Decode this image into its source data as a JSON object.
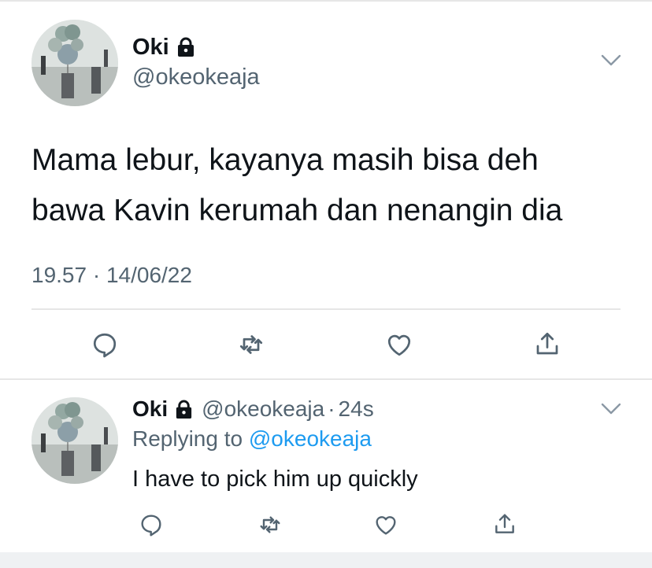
{
  "main_tweet": {
    "display_name": "Oki",
    "handle": "@okeokeaja",
    "text_line1": "Mama lebur, kayanya masih bisa deh",
    "text_line2": "bawa Kavin kerumah dan nenangin dia",
    "timestamp": "19.57 · 14/06/22"
  },
  "reply": {
    "display_name": "Oki",
    "handle": "@okeokeaja",
    "separator": "·",
    "time": "24s",
    "replying_prefix": "Replying to",
    "replying_mention": "@okeokeaja",
    "text": "I have to pick him up quickly"
  },
  "icons": {
    "lock": "lock-icon",
    "chevron": "chevron-down-icon",
    "reply": "reply-icon",
    "retweet": "retweet-icon",
    "like": "like-icon",
    "share": "share-icon"
  },
  "colors": {
    "text_primary": "#0f1419",
    "text_secondary": "#536471",
    "link": "#1d9bf0",
    "divider": "#e6e6e6",
    "icon": "#536471"
  }
}
